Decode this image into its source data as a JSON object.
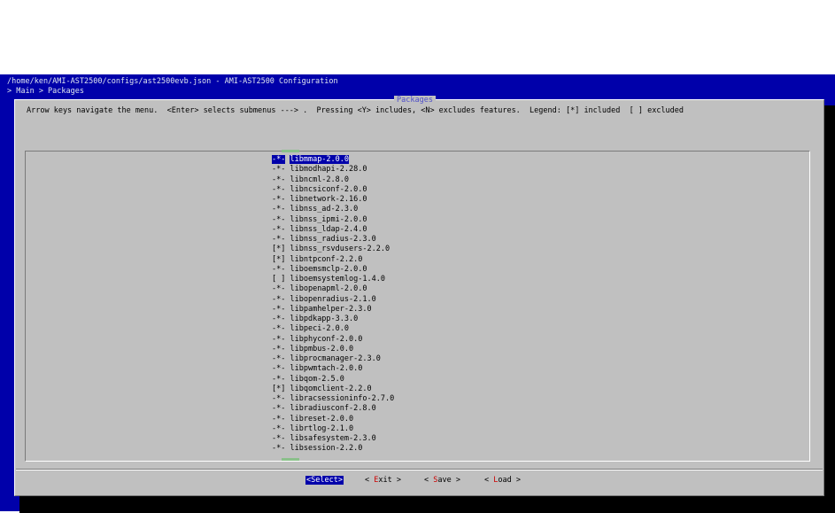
{
  "window": {
    "title": "/home/ken/AMI-AST2500/configs/ast2500evb.json - AMI-AST2500 Configuration",
    "breadcrumb": "> Main > Packages"
  },
  "dialog": {
    "title": "Packages",
    "help": "Arrow keys navigate the menu.  <Enter> selects submenus ---> .  Pressing <Y> includes, <N> excludes features.  Legend: [*] included  [ ] excluded"
  },
  "items": [
    {
      "mark": "-*-",
      "name": "libmmap-2.0.0",
      "selected": true
    },
    {
      "mark": "-*-",
      "name": "libmodhapi-2.28.0"
    },
    {
      "mark": "-*-",
      "name": "libncml-2.8.0"
    },
    {
      "mark": "-*-",
      "name": "libncsiconf-2.0.0"
    },
    {
      "mark": "-*-",
      "name": "libnetwork-2.16.0"
    },
    {
      "mark": "-*-",
      "name": "libnss_ad-2.3.0"
    },
    {
      "mark": "-*-",
      "name": "libnss_ipmi-2.0.0"
    },
    {
      "mark": "-*-",
      "name": "libnss_ldap-2.4.0"
    },
    {
      "mark": "-*-",
      "name": "libnss_radius-2.3.0"
    },
    {
      "mark": "[*]",
      "name": "libnss_rsvdusers-2.2.0"
    },
    {
      "mark": "[*]",
      "name": "libntpconf-2.2.0"
    },
    {
      "mark": "-*-",
      "name": "liboemsmclp-2.0.0"
    },
    {
      "mark": "[ ]",
      "name": "liboemsystemlog-1.4.0"
    },
    {
      "mark": "-*-",
      "name": "libopenapml-2.0.0"
    },
    {
      "mark": "-*-",
      "name": "libopenradius-2.1.0"
    },
    {
      "mark": "-*-",
      "name": "libpamhelper-2.3.0"
    },
    {
      "mark": "-*-",
      "name": "libpdkapp-3.3.0"
    },
    {
      "mark": "-*-",
      "name": "libpeci-2.0.0"
    },
    {
      "mark": "-*-",
      "name": "libphyconf-2.0.0"
    },
    {
      "mark": "-*-",
      "name": "libpmbus-2.0.0"
    },
    {
      "mark": "-*-",
      "name": "libprocmanager-2.3.0"
    },
    {
      "mark": "-*-",
      "name": "libpwmtach-2.0.0"
    },
    {
      "mark": "-*-",
      "name": "libqom-2.5.0"
    },
    {
      "mark": "[*]",
      "name": "libqomclient-2.2.0"
    },
    {
      "mark": "-*-",
      "name": "libracsessioninfo-2.7.0"
    },
    {
      "mark": "-*-",
      "name": "libradiusconf-2.8.0"
    },
    {
      "mark": "-*-",
      "name": "libreset-2.0.0"
    },
    {
      "mark": "-*-",
      "name": "librtlog-2.1.0"
    },
    {
      "mark": "-*-",
      "name": "libsafesystem-2.3.0"
    },
    {
      "mark": "-*-",
      "name": "libsession-2.2.0"
    }
  ],
  "buttons": {
    "select": {
      "open": "<",
      "hot": "S",
      "rest": "elect",
      "close": ">"
    },
    "exit": {
      "open": "< ",
      "hot": "E",
      "rest": "xit",
      "close": " >"
    },
    "save": {
      "open": "< ",
      "hot": "S",
      "rest": "ave",
      "close": " >"
    },
    "load": {
      "open": "< ",
      "hot": "L",
      "rest": "oad",
      "close": " >"
    }
  },
  "colors": {
    "terminal_bg": "#0000aa",
    "dialog_bg": "#c0c0c0",
    "highlight": "#0000aa",
    "hotkey": "#cc0000",
    "scroll_indicator": "#8ac08a"
  }
}
